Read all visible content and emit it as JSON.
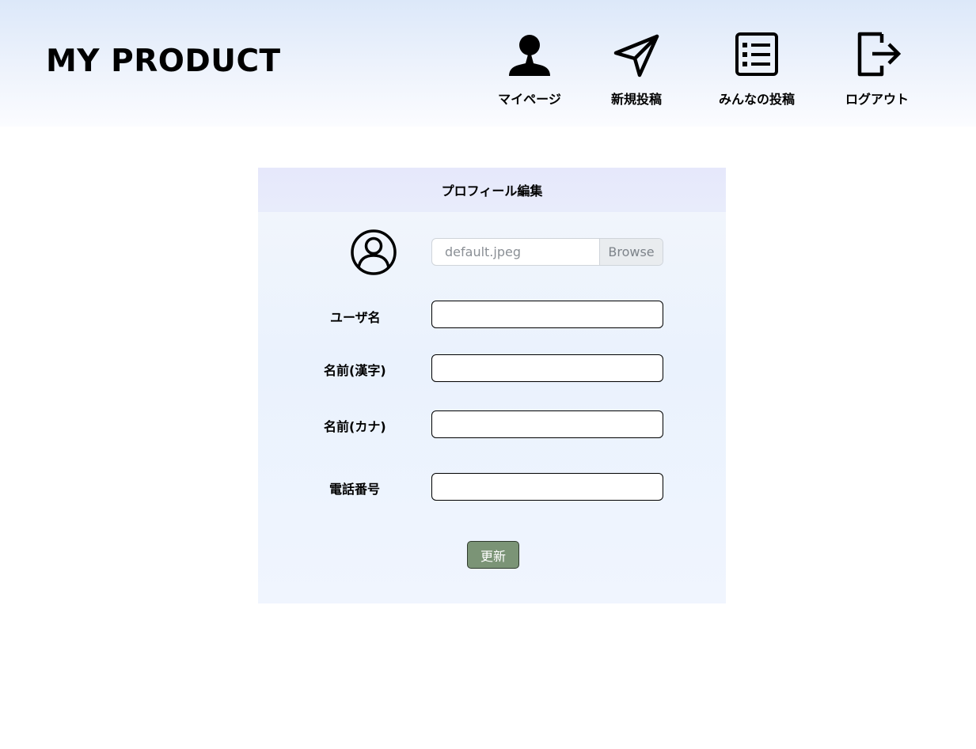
{
  "header": {
    "logo": "MY PRODUCT",
    "nav": [
      {
        "label": "マイページ",
        "icon": "user-icon"
      },
      {
        "label": "新規投稿",
        "icon": "send-icon"
      },
      {
        "label": "みんなの投稿",
        "icon": "list-icon"
      },
      {
        "label": "ログアウト",
        "icon": "logout-icon"
      }
    ]
  },
  "form": {
    "title": "プロフィール編集",
    "avatar_icon": "user-circle-icon",
    "file": {
      "name": "default.jpeg",
      "browse_label": "Browse"
    },
    "fields": [
      {
        "label": "ユーザ名",
        "value": ""
      },
      {
        "label": "名前(漢字)",
        "value": ""
      },
      {
        "label": "名前(カナ)",
        "value": ""
      },
      {
        "label": "電話番号",
        "value": ""
      }
    ],
    "submit_label": "更新"
  },
  "colors": {
    "header_gradient_top": "#dce8f9",
    "card_header": "#e6e8fb",
    "card_body": "#eef3fd",
    "submit_button": "#7b9476"
  }
}
